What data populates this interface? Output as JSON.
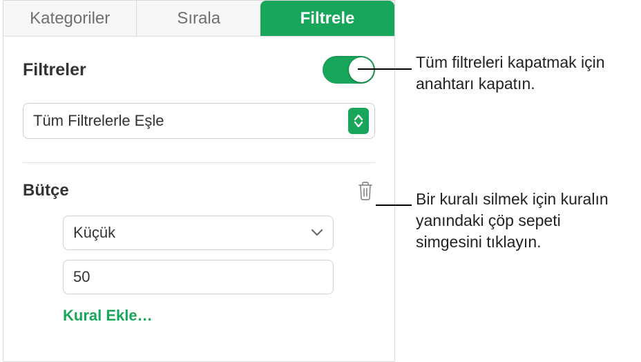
{
  "tabs": {
    "categories": "Kategoriler",
    "sort": "Sırala",
    "filter": "Filtrele"
  },
  "filters": {
    "title": "Filtreler",
    "match_mode": "Tüm Filtrelerle Eşle"
  },
  "rule": {
    "column": "Bütçe",
    "operator": "Küçük",
    "value": "50",
    "add_label": "Kural Ekle…"
  },
  "callouts": {
    "switch_help": "Tüm filtreleri kapatmak için anahtarı kapatın.",
    "trash_help": "Bir kuralı silmek için kuralın yanındaki çöp sepeti simgesini tıklayın."
  },
  "icons": {
    "trash": "trash-icon",
    "chevron": "chevron-down-icon",
    "stepper": "up-down-stepper-icon"
  }
}
